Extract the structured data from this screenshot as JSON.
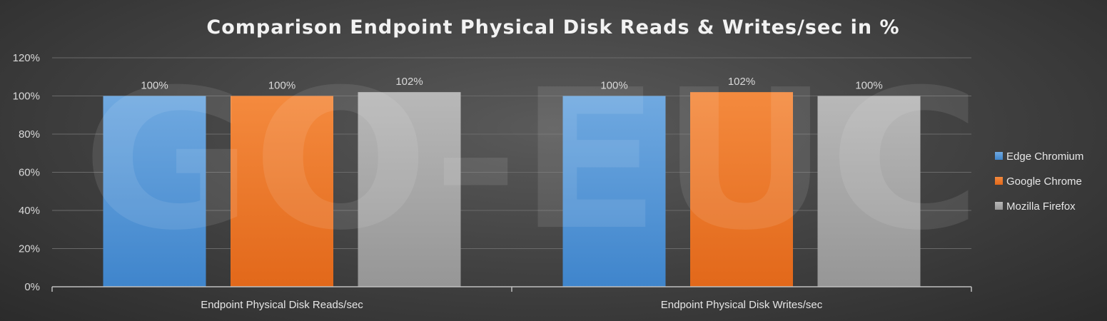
{
  "chart_data": {
    "type": "bar",
    "title": "Comparison Endpoint Physical Disk Reads & Writes/sec in %",
    "categories": [
      "Endpoint Physical Disk Reads/sec",
      "Endpoint Physical Disk Writes/sec"
    ],
    "series": [
      {
        "name": "Edge Chromium",
        "values": [
          100,
          100
        ],
        "labels": [
          "100%",
          "100%"
        ],
        "color": "#5b9bd5"
      },
      {
        "name": "Google Chrome",
        "values": [
          100,
          102
        ],
        "labels": [
          "100%",
          "102%"
        ],
        "color": "#ed7d31"
      },
      {
        "name": "Mozilla Firefox",
        "values": [
          102,
          100
        ],
        "labels": [
          "102%",
          "100%"
        ],
        "color": "#a5a5a5"
      }
    ],
    "yticks": [
      "0%",
      "20%",
      "40%",
      "60%",
      "80%",
      "100%",
      "120%"
    ],
    "ylim": [
      0,
      120
    ],
    "legend_position": "right",
    "grid": true,
    "watermark": "GO-EUC"
  }
}
